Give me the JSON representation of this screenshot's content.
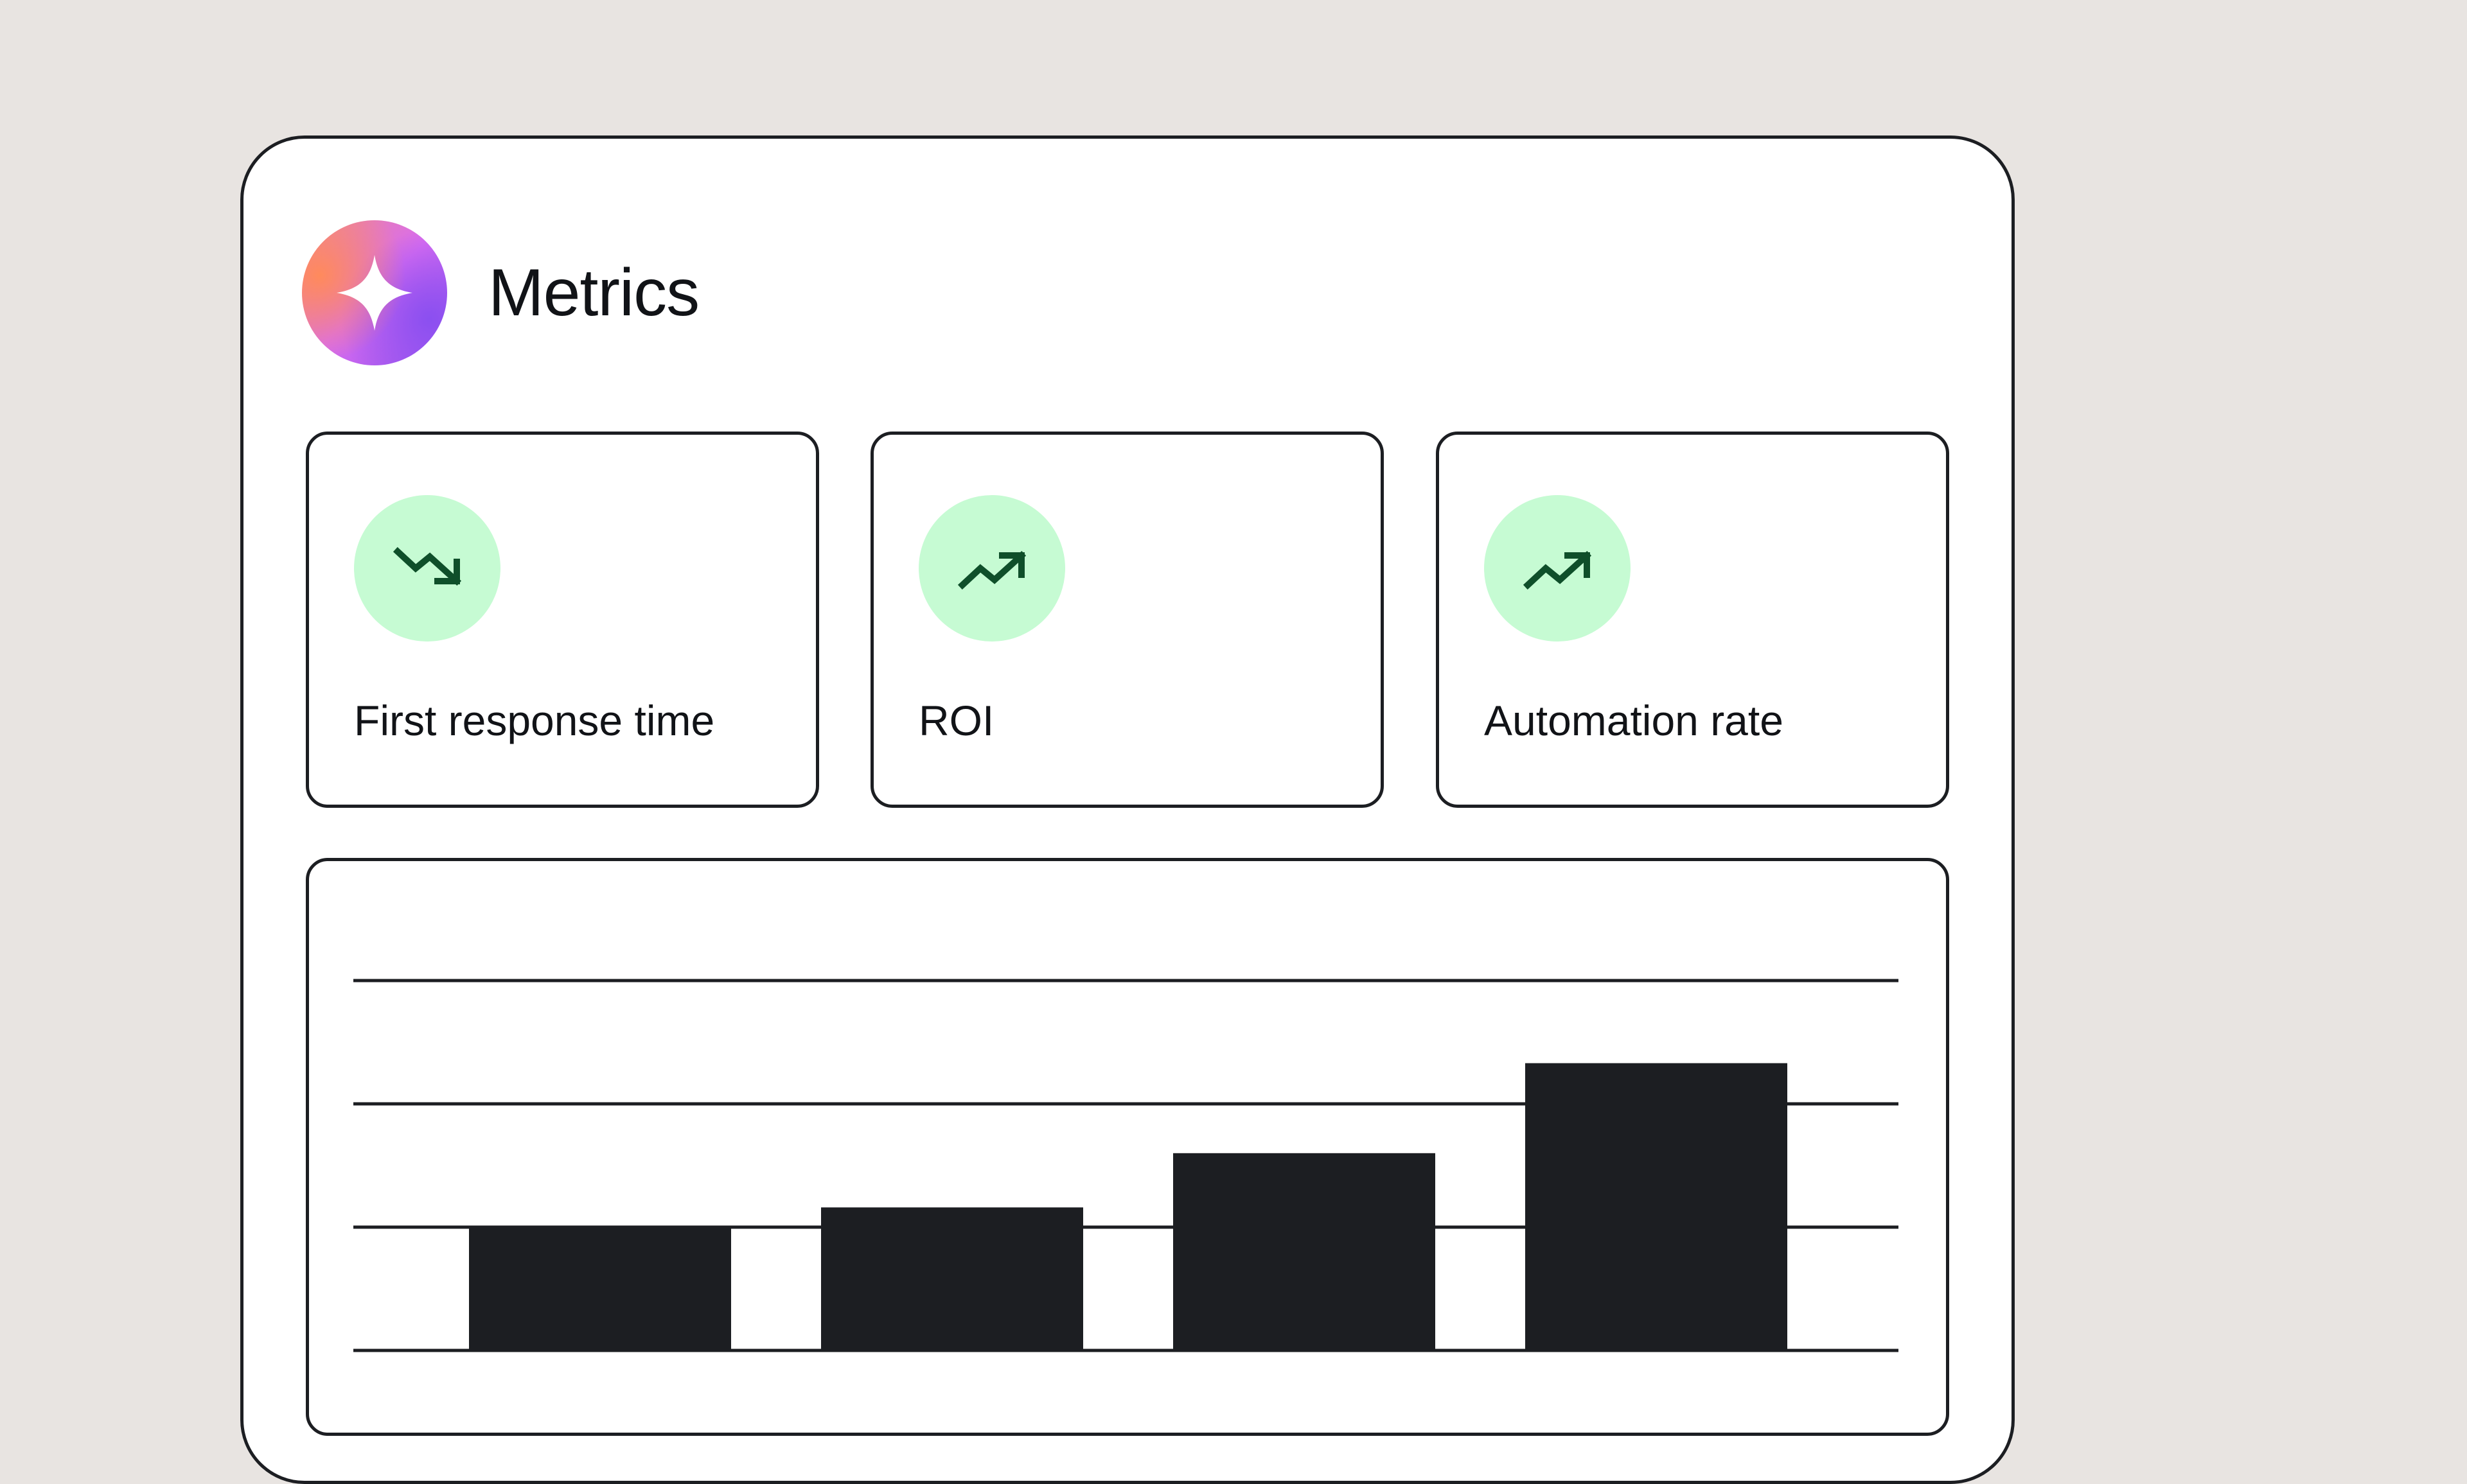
{
  "header": {
    "title": "Metrics",
    "logo_icon": "sparkle-icon"
  },
  "metrics": [
    {
      "label": "First response time",
      "trend": "down",
      "icon": "trending-down-icon"
    },
    {
      "label": "ROI",
      "trend": "up",
      "icon": "trending-up-icon"
    },
    {
      "label": "Automation rate",
      "trend": "up",
      "icon": "trending-up-icon"
    }
  ],
  "colors": {
    "background": "#e8e4e1",
    "panel": "#ffffff",
    "ink": "#1c1e22",
    "badge": "#c6fbd3",
    "trend_icon": "#0f4f2a"
  },
  "chart_data": {
    "type": "bar",
    "categories": [
      "",
      "",
      "",
      ""
    ],
    "values": [
      1.0,
      1.16,
      1.6,
      2.33
    ],
    "title": "",
    "xlabel": "",
    "ylabel": "",
    "ylim": [
      0,
      3
    ],
    "grid": true
  }
}
